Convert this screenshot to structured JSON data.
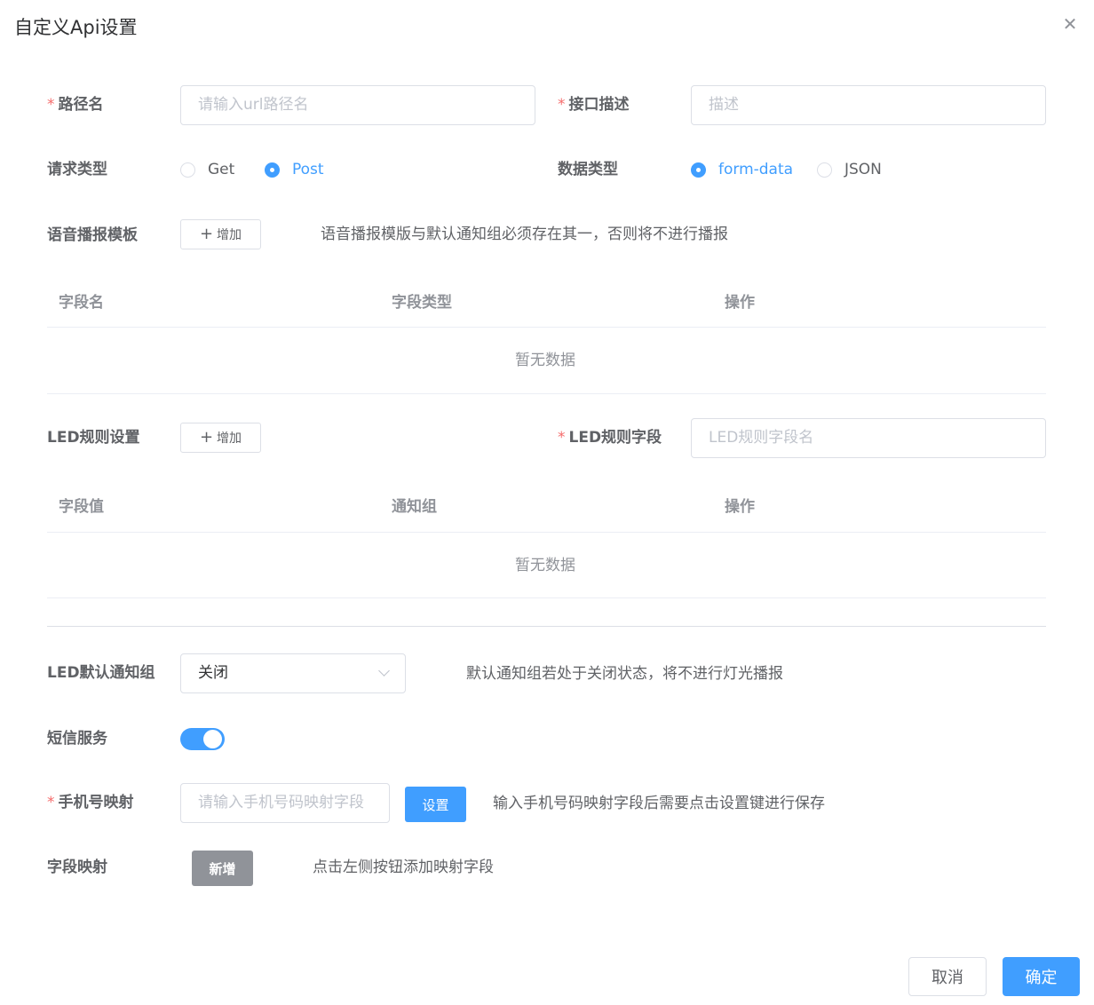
{
  "dialog": {
    "title": "自定义Api设置",
    "close_icon": "close-icon"
  },
  "form": {
    "path": {
      "required": "*",
      "label": "路径名",
      "placeholder": "请输入url路径名"
    },
    "desc": {
      "required": "*",
      "label": "接口描述",
      "placeholder": "描述"
    },
    "request_type": {
      "label": "请求类型",
      "options": [
        "Get",
        "Post"
      ],
      "selected": "Post"
    },
    "data_type": {
      "label": "数据类型",
      "options": [
        "form-data",
        "JSON"
      ],
      "selected": "form-data"
    },
    "voice_template": {
      "label": "语音播报模板",
      "add_label": "增加",
      "hint": "语音播报模版与默认通知组必须存在其一，否则将不进行播报",
      "columns": [
        "字段名",
        "字段类型",
        "操作"
      ],
      "empty_text": "暂无数据"
    },
    "led_rule": {
      "label": "LED规则设置",
      "add_label": "增加",
      "field_required": "*",
      "field_label": "LED规则字段",
      "field_placeholder": "LED规则字段名",
      "columns": [
        "字段值",
        "通知组",
        "操作"
      ],
      "empty_text": "暂无数据"
    },
    "led_default_group": {
      "label": "LED默认通知组",
      "value": "关闭",
      "hint": "默认通知组若处于关闭状态，将不进行灯光播报"
    },
    "sms": {
      "label": "短信服务",
      "enabled": true
    },
    "phone_mapping": {
      "required": "*",
      "label": "手机号映射",
      "placeholder": "请输入手机号码映射字段",
      "set_label": "设置",
      "hint": "输入手机号码映射字段后需要点击设置键进行保存"
    },
    "field_mapping": {
      "label": "字段映射",
      "add_label": "新增",
      "hint": "点击左侧按钮添加映射字段"
    }
  },
  "footer": {
    "cancel_label": "取消",
    "confirm_label": "确定"
  },
  "colors": {
    "primary": "#409eff",
    "required": "#f56c6c",
    "gray_button": "#909399"
  }
}
